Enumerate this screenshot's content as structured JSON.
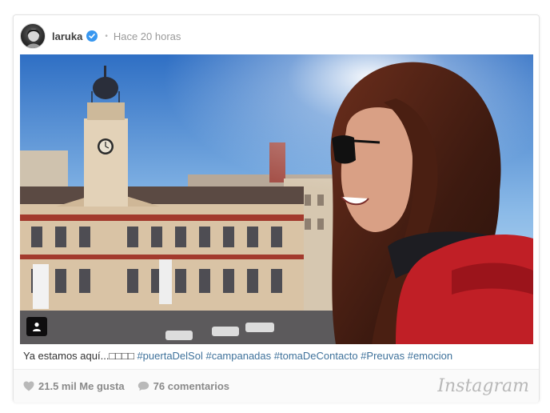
{
  "post": {
    "username": "laruka",
    "dot": "•",
    "time": "Hace 20 horas",
    "caption_text": "Ya estamos aquí...□□□□ ",
    "hashtags": [
      "#puertaDelSol",
      "#campanadas",
      "#tomaDeContacto",
      "#Preuvas",
      "#emocion"
    ],
    "likes": "21.5 mil Me gusta",
    "comments": "76 comentarios",
    "brand": "Instagram"
  },
  "icons": {
    "verified": "verified-badge-icon",
    "person_tag": "user-tag-icon",
    "like": "heart-icon",
    "comment": "comment-bubble-icon"
  },
  "colors": {
    "verified": "#3897f0",
    "hashtag": "#3f729b",
    "stat_text": "#8a8a8a"
  }
}
